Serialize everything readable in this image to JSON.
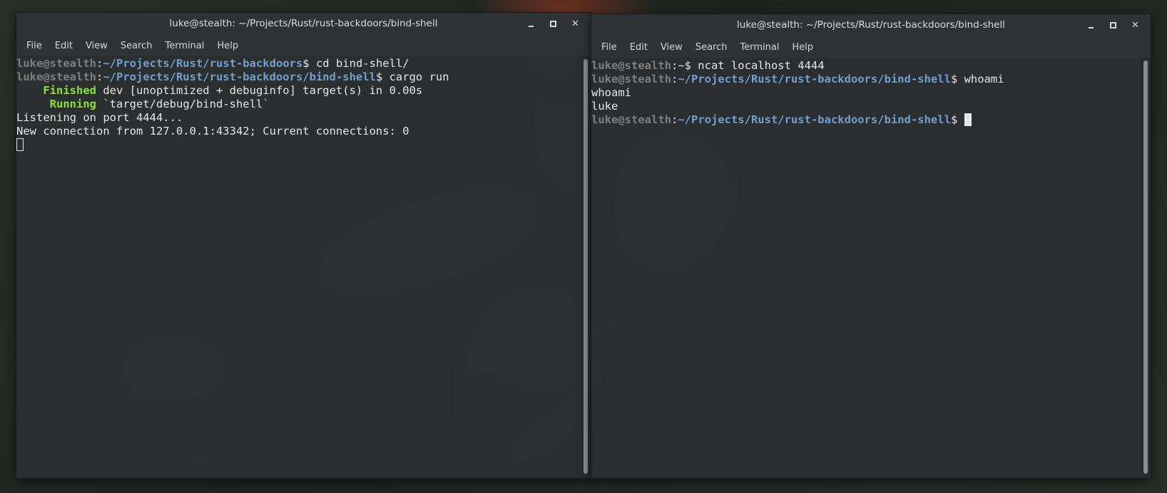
{
  "left_window": {
    "title": "luke@stealth: ~/Projects/Rust/rust-backdoors/bind-shell",
    "menu": [
      "File",
      "Edit",
      "View",
      "Search",
      "Terminal",
      "Help"
    ],
    "lines": [
      [
        {
          "cls": "u",
          "text": "luke@stealth"
        },
        {
          "cls": "t",
          "text": ":"
        },
        {
          "cls": "p",
          "text": "~/Projects/Rust/rust-backdoors"
        },
        {
          "cls": "t",
          "text": "$ cd bind-shell/"
        }
      ],
      [
        {
          "cls": "u",
          "text": "luke@stealth"
        },
        {
          "cls": "t",
          "text": ":"
        },
        {
          "cls": "p",
          "text": "~/Projects/Rust/rust-backdoors/bind-shell"
        },
        {
          "cls": "t",
          "text": "$ cargo run"
        }
      ],
      [
        {
          "cls": "t",
          "text": "    "
        },
        {
          "cls": "g",
          "text": "Finished"
        },
        {
          "cls": "t",
          "text": " dev [unoptimized + debuginfo] target(s) in 0.00s"
        }
      ],
      [
        {
          "cls": "t",
          "text": "     "
        },
        {
          "cls": "g",
          "text": "Running"
        },
        {
          "cls": "t",
          "text": " `target/debug/bind-shell`"
        }
      ],
      [
        {
          "cls": "t",
          "text": "Listening on port 4444..."
        }
      ],
      [
        {
          "cls": "t",
          "text": "New connection from 127.0.0.1:43342; Current connections: 0"
        }
      ]
    ]
  },
  "right_window": {
    "title": "luke@stealth: ~/Projects/Rust/rust-backdoors/bind-shell",
    "menu": [
      "File",
      "Edit",
      "View",
      "Search",
      "Terminal",
      "Help"
    ],
    "lines": [
      [
        {
          "cls": "u",
          "text": "luke@stealth"
        },
        {
          "cls": "t",
          "text": ":~$ ncat localhost 4444"
        }
      ],
      [
        {
          "cls": "u",
          "text": "luke@stealth"
        },
        {
          "cls": "t",
          "text": ":"
        },
        {
          "cls": "p",
          "text": "~/Projects/Rust/rust-backdoors/bind-shell"
        },
        {
          "cls": "t",
          "text": "$ whoami"
        }
      ],
      [
        {
          "cls": "t",
          "text": "whoami"
        }
      ],
      [
        {
          "cls": "t",
          "text": "luke"
        }
      ],
      [
        {
          "cls": "u",
          "text": "luke@stealth"
        },
        {
          "cls": "t",
          "text": ":"
        },
        {
          "cls": "p",
          "text": "~/Projects/Rust/rust-backdoors/bind-shell"
        },
        {
          "cls": "t",
          "text": "$ "
        }
      ]
    ]
  },
  "colors": {
    "user_host": "#7f7f7f",
    "path": "#729fcf",
    "cargo_status": "#8ae234",
    "text": "#e6e6e6"
  },
  "icons": {
    "minimize": "minimize-icon",
    "maximize": "maximize-icon",
    "close": "close-icon"
  }
}
